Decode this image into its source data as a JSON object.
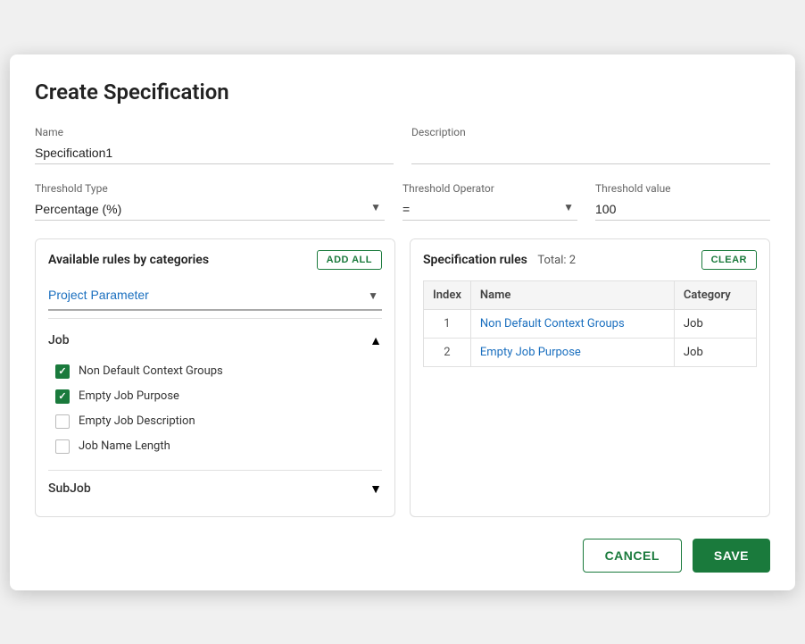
{
  "dialog": {
    "title": "Create Specification"
  },
  "form": {
    "name_label": "Name",
    "name_value": "Specification1",
    "description_label": "Description",
    "description_value": ""
  },
  "threshold": {
    "type_label": "Threshold Type",
    "type_value": "Percentage (%)",
    "operator_label": "Threshold Operator",
    "operator_value": "=",
    "value_label": "Threshold value",
    "value_value": "100"
  },
  "available_panel": {
    "title": "Available rules by categories",
    "add_all_label": "ADD ALL",
    "category_value": "Project Parameter",
    "job_label": "Job",
    "rules": [
      {
        "id": 1,
        "label": "Non Default Context Groups",
        "checked": true
      },
      {
        "id": 2,
        "label": "Empty Job Purpose",
        "checked": true
      },
      {
        "id": 3,
        "label": "Empty Job Description",
        "checked": false
      },
      {
        "id": 4,
        "label": "Job Name Length",
        "checked": false
      }
    ],
    "subjob_label": "SubJob"
  },
  "spec_panel": {
    "title": "Specification rules",
    "total_label": "Total: 2",
    "clear_label": "CLEAR",
    "table": {
      "col_index": "Index",
      "col_name": "Name",
      "col_category": "Category",
      "rows": [
        {
          "index": "1",
          "name": "Non Default Context Groups",
          "category": "Job"
        },
        {
          "index": "2",
          "name": "Empty Job Purpose",
          "category": "Job"
        }
      ]
    }
  },
  "footer": {
    "cancel_label": "CANCEL",
    "save_label": "SAVE"
  }
}
